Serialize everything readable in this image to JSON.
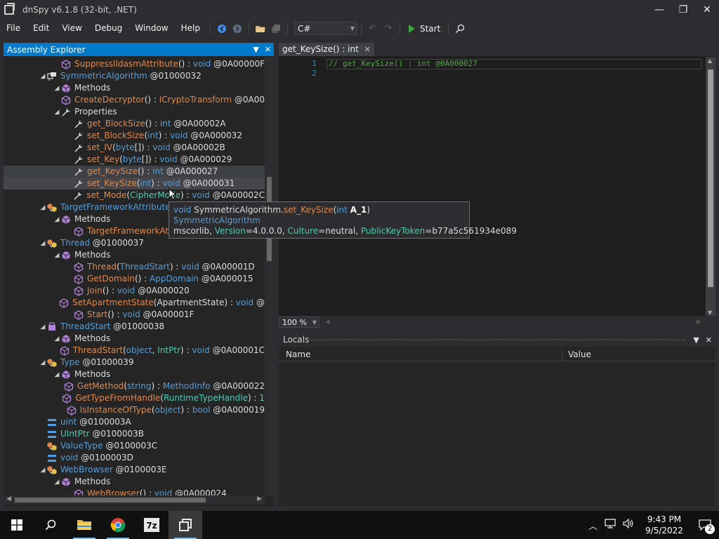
{
  "window": {
    "title": "dnSpy v6.1.8 (32-bit, .NET)",
    "controls": {
      "minimize": "—",
      "maximize": "❐",
      "close": "✕"
    }
  },
  "menu": [
    "File",
    "Edit",
    "View",
    "Debug",
    "Window",
    "Help"
  ],
  "toolbar": {
    "language": "C#",
    "start_label": "Start"
  },
  "explorer": {
    "title": "Assembly Explorer",
    "rows": [
      {
        "depth": 4,
        "exp": "",
        "icon": "method",
        "parts": [
          [
            "SuppressIldasmAttribute",
            "m"
          ],
          [
            "() : ",
            "t"
          ],
          [
            "void",
            "k"
          ],
          [
            " @0A00000F",
            "t"
          ]
        ]
      },
      {
        "depth": 2,
        "exp": "▲",
        "icon": "class",
        "parts": [
          [
            "SymmetricAlgorithm",
            "c"
          ],
          [
            " @01000032",
            "t"
          ]
        ]
      },
      {
        "depth": 3,
        "exp": "▲",
        "icon": "methods",
        "parts": [
          [
            "Methods",
            "t"
          ]
        ]
      },
      {
        "depth": 4,
        "exp": "",
        "icon": "method",
        "parts": [
          [
            "CreateDecryptor",
            "m"
          ],
          [
            "() : ",
            "t"
          ],
          [
            "ICryptoTransform",
            "m"
          ],
          [
            " @0A00",
            "t"
          ]
        ]
      },
      {
        "depth": 3,
        "exp": "▲",
        "icon": "wrench",
        "parts": [
          [
            "Properties",
            "t"
          ]
        ]
      },
      {
        "depth": 4,
        "exp": "",
        "icon": "wrench",
        "parts": [
          [
            "get_BlockSize",
            "m"
          ],
          [
            "() : ",
            "t"
          ],
          [
            "int",
            "k"
          ],
          [
            " @0A00002A",
            "t"
          ]
        ]
      },
      {
        "depth": 4,
        "exp": "",
        "icon": "wrench",
        "parts": [
          [
            "set_BlockSize",
            "m"
          ],
          [
            "(",
            "t"
          ],
          [
            "int",
            "k"
          ],
          [
            ") : ",
            "t"
          ],
          [
            "void",
            "k"
          ],
          [
            " @0A000032",
            "t"
          ]
        ]
      },
      {
        "depth": 4,
        "exp": "",
        "icon": "wrench",
        "parts": [
          [
            "set_IV",
            "m"
          ],
          [
            "(",
            "t"
          ],
          [
            "byte",
            "k"
          ],
          [
            "[]) : ",
            "t"
          ],
          [
            "void",
            "k"
          ],
          [
            " @0A00002B",
            "t"
          ]
        ]
      },
      {
        "depth": 4,
        "exp": "",
        "icon": "wrench",
        "parts": [
          [
            "set_Key",
            "m"
          ],
          [
            "(",
            "t"
          ],
          [
            "byte",
            "k"
          ],
          [
            "[]) : ",
            "t"
          ],
          [
            "void",
            "k"
          ],
          [
            " @0A000029",
            "t"
          ]
        ]
      },
      {
        "depth": 4,
        "exp": "",
        "icon": "wrench",
        "sel": 1,
        "parts": [
          [
            "get_KeySize",
            "m"
          ],
          [
            "() : ",
            "t"
          ],
          [
            "int",
            "k"
          ],
          [
            " @0A000027",
            "t"
          ]
        ]
      },
      {
        "depth": 4,
        "exp": "",
        "icon": "wrench",
        "sel": 2,
        "parts": [
          [
            "set_KeySize",
            "m"
          ],
          [
            "(",
            "t"
          ],
          [
            "int",
            "k"
          ],
          [
            ") : ",
            "t"
          ],
          [
            "void",
            "k"
          ],
          [
            " @0A000031",
            "t"
          ]
        ]
      },
      {
        "depth": 4,
        "exp": "",
        "icon": "wrench",
        "parts": [
          [
            "set_Mode",
            "m"
          ],
          [
            "(",
            "t"
          ],
          [
            "CipherMode",
            "g"
          ],
          [
            ") : ",
            "t"
          ],
          [
            "void",
            "k"
          ],
          [
            " @0A00002C",
            "t"
          ]
        ]
      },
      {
        "depth": 2,
        "exp": "▲",
        "icon": "attr",
        "parts": [
          [
            "TargetFrameworkAttribute",
            "c"
          ]
        ]
      },
      {
        "depth": 3,
        "exp": "▲",
        "icon": "methods",
        "parts": [
          [
            "Methods",
            "t"
          ]
        ]
      },
      {
        "depth": 4,
        "exp": "",
        "icon": "method",
        "parts": [
          [
            "TargetFrameworkAt",
            "m"
          ]
        ]
      },
      {
        "depth": 2,
        "exp": "▲",
        "icon": "attr",
        "parts": [
          [
            "Thread",
            "c"
          ],
          [
            " @01000037",
            "t"
          ]
        ]
      },
      {
        "depth": 3,
        "exp": "▲",
        "icon": "methods",
        "parts": [
          [
            "Methods",
            "t"
          ]
        ]
      },
      {
        "depth": 4,
        "exp": "",
        "icon": "method",
        "parts": [
          [
            "Thread",
            "m"
          ],
          [
            "(",
            "t"
          ],
          [
            "ThreadStart",
            "c"
          ],
          [
            ") : ",
            "t"
          ],
          [
            "void",
            "k"
          ],
          [
            " @0A00001D",
            "t"
          ]
        ]
      },
      {
        "depth": 4,
        "exp": "",
        "icon": "method",
        "parts": [
          [
            "GetDomain",
            "m"
          ],
          [
            "() : ",
            "t"
          ],
          [
            "AppDomain",
            "c"
          ],
          [
            " @0A000015",
            "t"
          ]
        ]
      },
      {
        "depth": 4,
        "exp": "",
        "icon": "method",
        "parts": [
          [
            "Join",
            "m"
          ],
          [
            "() : ",
            "t"
          ],
          [
            "void",
            "k"
          ],
          [
            " @0A000020",
            "t"
          ]
        ]
      },
      {
        "depth": 4,
        "exp": "",
        "icon": "method",
        "parts": [
          [
            "SetApartmentState",
            "m"
          ],
          [
            "(ApartmentState) : ",
            "t"
          ],
          [
            "void",
            "k"
          ],
          [
            " @",
            "t"
          ]
        ]
      },
      {
        "depth": 4,
        "exp": "",
        "icon": "method",
        "parts": [
          [
            "Start",
            "m"
          ],
          [
            "() : ",
            "t"
          ],
          [
            "void",
            "k"
          ],
          [
            " @0A00001F",
            "t"
          ]
        ]
      },
      {
        "depth": 2,
        "exp": "▲",
        "icon": "delegate",
        "parts": [
          [
            "ThreadStart",
            "c"
          ],
          [
            " @01000038",
            "t"
          ]
        ]
      },
      {
        "depth": 3,
        "exp": "▲",
        "icon": "methods",
        "parts": [
          [
            "Methods",
            "t"
          ]
        ]
      },
      {
        "depth": 4,
        "exp": "",
        "icon": "method",
        "parts": [
          [
            "ThreadStart",
            "m"
          ],
          [
            "(",
            "t"
          ],
          [
            "object",
            "k"
          ],
          [
            ", ",
            "t"
          ],
          [
            "IntPtr",
            "g"
          ],
          [
            ") : ",
            "t"
          ],
          [
            "void",
            "k"
          ],
          [
            " @0A00001C",
            "t"
          ]
        ]
      },
      {
        "depth": 2,
        "exp": "▲",
        "icon": "attr",
        "parts": [
          [
            "Type",
            "c"
          ],
          [
            " @01000039",
            "t"
          ]
        ]
      },
      {
        "depth": 3,
        "exp": "▲",
        "icon": "methods",
        "parts": [
          [
            "Methods",
            "t"
          ]
        ]
      },
      {
        "depth": 4,
        "exp": "",
        "icon": "method",
        "parts": [
          [
            "GetMethod",
            "m"
          ],
          [
            "(",
            "t"
          ],
          [
            "string",
            "k"
          ],
          [
            ") : ",
            "t"
          ],
          [
            "MethodInfo",
            "c"
          ],
          [
            " @0A000022",
            "t"
          ]
        ]
      },
      {
        "depth": 4,
        "exp": "",
        "icon": "method",
        "parts": [
          [
            "GetTypeFromHandle",
            "m"
          ],
          [
            "(",
            "t"
          ],
          [
            "RuntimeTypeHandle",
            "g"
          ],
          [
            ") : ",
            "t"
          ],
          [
            "1",
            "g"
          ]
        ]
      },
      {
        "depth": 4,
        "exp": "",
        "icon": "method",
        "parts": [
          [
            "IsInstanceOfType",
            "m"
          ],
          [
            "(",
            "t"
          ],
          [
            "object",
            "k"
          ],
          [
            ") : ",
            "t"
          ],
          [
            "bool",
            "k"
          ],
          [
            " @0A000019",
            "t"
          ]
        ]
      },
      {
        "depth": 2,
        "exp": "",
        "icon": "struct",
        "parts": [
          [
            "uint",
            "k"
          ],
          [
            " @0100003A",
            "t"
          ]
        ]
      },
      {
        "depth": 2,
        "exp": "",
        "icon": "struct",
        "parts": [
          [
            "UIntPtr",
            "g"
          ],
          [
            " @0100003B",
            "t"
          ]
        ]
      },
      {
        "depth": 2,
        "exp": "",
        "icon": "attr",
        "parts": [
          [
            "ValueType",
            "c"
          ],
          [
            " @0100003C",
            "t"
          ]
        ]
      },
      {
        "depth": 2,
        "exp": "",
        "icon": "struct",
        "parts": [
          [
            "void",
            "k"
          ],
          [
            " @0100003D",
            "t"
          ]
        ]
      },
      {
        "depth": 2,
        "exp": "▲",
        "icon": "attr",
        "parts": [
          [
            "WebBrowser",
            "c"
          ],
          [
            " @0100003E",
            "t"
          ]
        ]
      },
      {
        "depth": 3,
        "exp": "▲",
        "icon": "methods",
        "parts": [
          [
            "Methods",
            "t"
          ]
        ]
      },
      {
        "depth": 4,
        "exp": "",
        "icon": "method",
        "parts": [
          [
            "WebBrowser",
            "m"
          ],
          [
            "() : ",
            "t"
          ],
          [
            "void",
            "k"
          ],
          [
            " @0A000024",
            "t"
          ]
        ]
      }
    ]
  },
  "editor": {
    "tab_label": "get_KeySize() : int",
    "lines": [
      {
        "num": "1",
        "text": "// get_KeySize() : int @0A000027"
      },
      {
        "num": "2",
        "text": ""
      }
    ],
    "zoom": "100 %"
  },
  "tooltip": {
    "line1": [
      [
        "void",
        "k"
      ],
      [
        " SymmetricAlgorithm.",
        "t"
      ],
      [
        "set_KeySize",
        "m"
      ],
      [
        "(",
        "t"
      ],
      [
        "int",
        "k"
      ],
      [
        " ",
        "t"
      ],
      [
        "A_1",
        "b"
      ],
      [
        ")",
        "t"
      ]
    ],
    "line2": [
      [
        "SymmetricAlgorithm",
        "c"
      ]
    ],
    "line3": [
      [
        "mscorlib, ",
        "t"
      ],
      [
        "Version",
        "g"
      ],
      [
        "=4.0.0.0, ",
        "t"
      ],
      [
        "Culture",
        "g"
      ],
      [
        "=neutral, ",
        "t"
      ],
      [
        "PublicKeyToken",
        "g"
      ],
      [
        "=b77a5c561934e089",
        "t"
      ]
    ]
  },
  "locals": {
    "title": "Locals",
    "columns": [
      "Name",
      "Value"
    ]
  },
  "taskbar": {
    "time": "9:43 PM",
    "date": "9/5/2022",
    "notification_count": "2",
    "apps": [
      "file-explorer",
      "chrome",
      "7-zip",
      "dnspy"
    ]
  },
  "colors": {
    "accent": "#007acc",
    "keyword": "#569cd6",
    "method": "#e0884a",
    "type": "#4ec9b0",
    "comment": "#57a64a"
  }
}
